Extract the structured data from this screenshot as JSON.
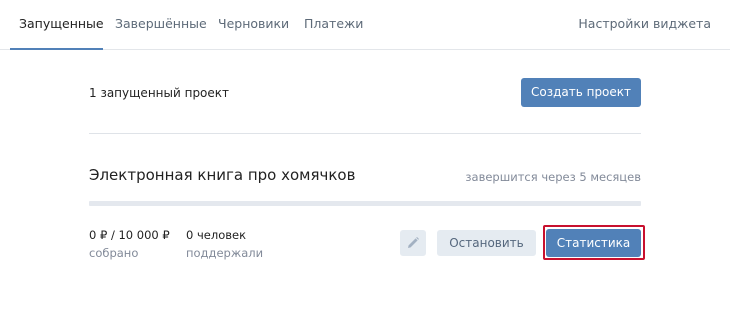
{
  "tabs": {
    "items": [
      {
        "label": "Запущенные",
        "active": true
      },
      {
        "label": "Завершённые",
        "active": false
      },
      {
        "label": "Черновики",
        "active": false
      },
      {
        "label": "Платежи",
        "active": false
      }
    ],
    "widget_settings_label": "Настройки виджета"
  },
  "summary": {
    "count_text": "1 запущенный проект",
    "create_button_label": "Создать проект"
  },
  "project": {
    "title": "Электронная книга про хомячков",
    "deadline": "завершится через 5 месяцев",
    "progress_fraction": 0,
    "collected_value": "0 ₽ / 10 000 ₽",
    "collected_label": "собрано",
    "backers_value": "0 человек",
    "backers_label": "поддержали",
    "edit_icon": "pencil-icon",
    "stop_button_label": "Остановить",
    "stats_button_label": "Статистика"
  },
  "colors": {
    "accent": "#5181b8",
    "secondary_button_bg": "#e5ebf1",
    "highlight_border": "#c8102e",
    "muted_text": "#828a99"
  }
}
